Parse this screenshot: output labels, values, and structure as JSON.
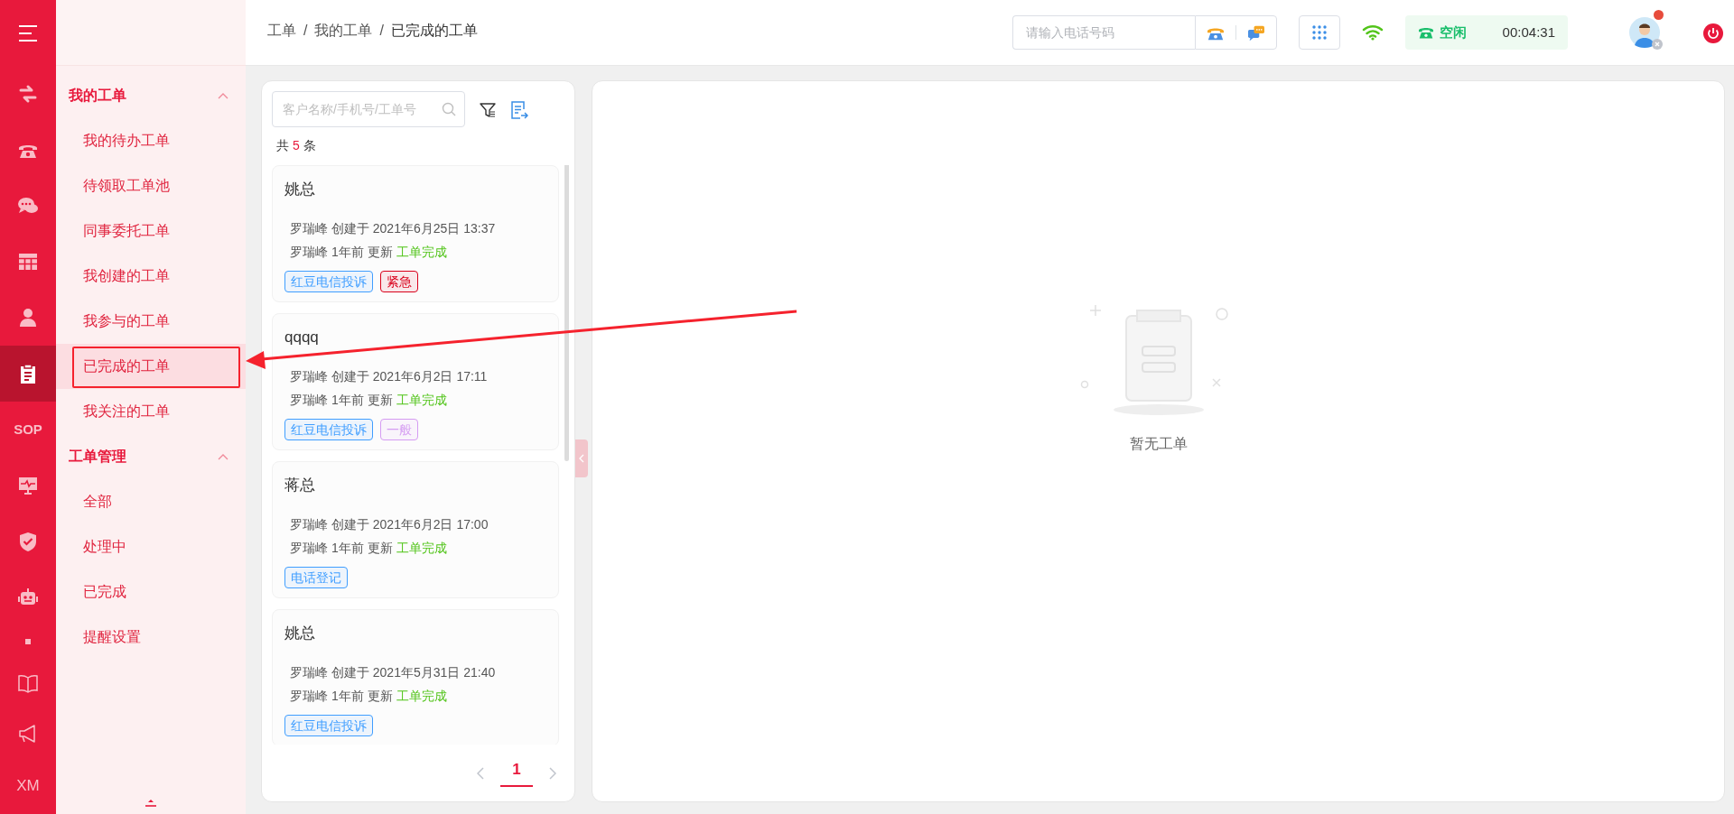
{
  "rail": {
    "items": [
      {
        "selected": false
      },
      {
        "selected": false
      },
      {
        "selected": false
      },
      {
        "selected": false
      },
      {
        "selected": false
      },
      {
        "selected": true
      },
      {
        "label": "SOP",
        "selected": false
      },
      {
        "selected": false
      },
      {
        "selected": false
      },
      {
        "selected": false
      },
      {
        "selected": false
      },
      {
        "selected": false
      },
      {
        "selected": false
      },
      {
        "label": "XM",
        "selected": false
      }
    ]
  },
  "sidebar": {
    "groups": [
      {
        "title": "我的工单",
        "expanded": true,
        "items": [
          {
            "label": "我的待办工单",
            "selected": false
          },
          {
            "label": "待领取工单池",
            "selected": false
          },
          {
            "label": "同事委托工单",
            "selected": false
          },
          {
            "label": "我创建的工单",
            "selected": false
          },
          {
            "label": "我参与的工单",
            "selected": false
          },
          {
            "label": "已完成的工单",
            "selected": true
          },
          {
            "label": "我关注的工单",
            "selected": false
          }
        ]
      },
      {
        "title": "工单管理",
        "expanded": true,
        "items": [
          {
            "label": "全部",
            "selected": false
          },
          {
            "label": "处理中",
            "selected": false
          },
          {
            "label": "已完成",
            "selected": false
          },
          {
            "label": "提醒设置",
            "selected": false
          }
        ]
      }
    ]
  },
  "breadcrumb": {
    "separator": "/",
    "items": [
      "工单",
      "我的工单",
      "已完成的工单"
    ]
  },
  "header": {
    "phone_field": {
      "placeholder": "请输入电话号码"
    },
    "agent_status": {
      "label": "空闲",
      "timer": "00:04:31"
    },
    "avatar": {
      "notification": true
    }
  },
  "list_panel": {
    "search": {
      "placeholder": "客户名称/手机号/工单号"
    },
    "total": {
      "prefix": "共",
      "count": "5",
      "suffix": "条"
    },
    "tickets": [
      {
        "title": "姚总",
        "created": "罗瑞峰 创建于 2021年6月25日 13:37",
        "updated": "罗瑞峰 1年前 更新",
        "status": "工单完成",
        "tags": [
          {
            "label": "红豆电信投诉",
            "color": "#409eff"
          },
          {
            "label": "紧急",
            "color": "#d9001b"
          }
        ]
      },
      {
        "title": "qqqq",
        "created": "罗瑞峰 创建于 2021年6月2日 17:11",
        "updated": "罗瑞峰 1年前 更新",
        "status": "工单完成",
        "tags": [
          {
            "label": "红豆电信投诉",
            "color": "#409eff"
          },
          {
            "label": "一般",
            "color": "#d59cf2"
          }
        ]
      },
      {
        "title": "蒋总",
        "created": "罗瑞峰 创建于 2021年6月2日 17:00",
        "updated": "罗瑞峰 1年前 更新",
        "status": "工单完成",
        "tags": [
          {
            "label": "电话登记",
            "color": "#409eff"
          }
        ]
      },
      {
        "title": "姚总",
        "created": "罗瑞峰 创建于 2021年5月31日 21:40",
        "updated": "罗瑞峰 1年前 更新",
        "status": "工单完成",
        "tags": [
          {
            "label": "红豆电信投诉",
            "color": "#409eff"
          }
        ]
      }
    ],
    "pagination": {
      "pages": [
        {
          "label": "1",
          "selected": true
        }
      ]
    }
  },
  "detail_panel": {
    "empty_text": "暂无工单"
  }
}
